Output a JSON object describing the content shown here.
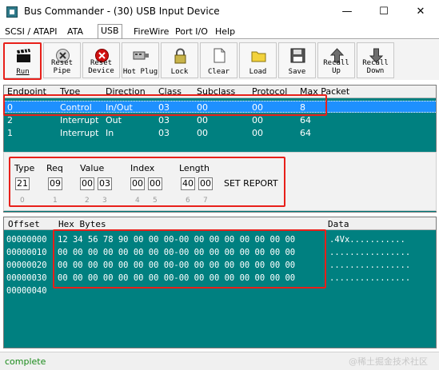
{
  "window": {
    "title": "Bus Commander - (30) USB Input Device",
    "minimize_glyph": "—",
    "maximize_glyph": "☐",
    "close_glyph": "✕"
  },
  "tabs": [
    {
      "label": "SCSI / ATAPI",
      "selected": false
    },
    {
      "label": "ATA",
      "selected": false
    },
    {
      "label": "USB",
      "selected": true
    },
    {
      "label": "FireWire",
      "selected": false
    },
    {
      "label": "Port I/O",
      "selected": false
    },
    {
      "label": "Help",
      "selected": false
    }
  ],
  "toolbar": {
    "run": "Run",
    "reset_pipe_1": "Reset",
    "reset_pipe_2": "Pipe",
    "reset_device_1": "Reset",
    "reset_device_2": "Device",
    "hot_plug": "Hot Plug",
    "lock": "Lock",
    "clear": "Clear",
    "load": "Load",
    "save": "Save",
    "recall_up_1": "Recall",
    "recall_up_2": "Up",
    "recall_down_1": "Recall",
    "recall_down_2": "Down"
  },
  "endpoints": {
    "columns": [
      "Endpoint",
      "Type",
      "Direction",
      "Class",
      "Subclass",
      "Protocol",
      "Max Packet"
    ],
    "rows": [
      {
        "endpoint": "0",
        "type": "Control",
        "direction": "In/Out",
        "class": "03",
        "subclass": "00",
        "protocol": "00",
        "max_packet": "8",
        "selected": true
      },
      {
        "endpoint": "2",
        "type": "Interrupt",
        "direction": "Out",
        "class": "03",
        "subclass": "00",
        "protocol": "00",
        "max_packet": "64",
        "selected": false
      },
      {
        "endpoint": "1",
        "type": "Interrupt",
        "direction": "In",
        "class": "03",
        "subclass": "00",
        "protocol": "00",
        "max_packet": "64",
        "selected": false
      }
    ]
  },
  "setup": {
    "type_label": "Type",
    "req_label": "Req",
    "value_label": "Value",
    "index_label": "Index",
    "length_label": "Length",
    "type": "21",
    "req": "09",
    "value_lo": "00",
    "value_hi": "03",
    "index_lo": "00",
    "index_hi": "00",
    "length_lo": "40",
    "length_hi": "00",
    "request_name": "SET REPORT",
    "byte_indices": [
      "0",
      "1",
      "2",
      "3",
      "4",
      "5",
      "6",
      "7"
    ]
  },
  "hex": {
    "offset_header": "Offset",
    "bytes_header": "Hex Bytes",
    "data_header": "Data",
    "rows": [
      {
        "offset": "00000000",
        "bytes": "12 34 56 78 90 00 00 00-00 00 00 00 00 00 00 00",
        "data": ".4Vx..........."
      },
      {
        "offset": "00000010",
        "bytes": "00 00 00 00 00 00 00 00-00 00 00 00 00 00 00 00",
        "data": "................"
      },
      {
        "offset": "00000020",
        "bytes": "00 00 00 00 00 00 00 00-00 00 00 00 00 00 00 00",
        "data": "................"
      },
      {
        "offset": "00000030",
        "bytes": "00 00 00 00 00 00 00 00-00 00 00 00 00 00 00 00",
        "data": "................"
      },
      {
        "offset": "00000040",
        "bytes": "",
        "data": ""
      }
    ]
  },
  "status": {
    "text": "complete",
    "watermark": "@稀土掘金技术社区"
  }
}
